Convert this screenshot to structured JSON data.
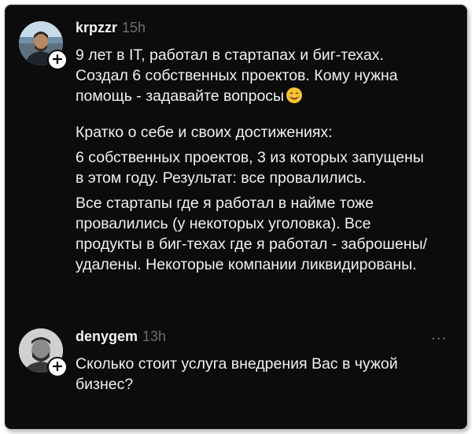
{
  "posts": [
    {
      "username": "krpzzr",
      "time": "15h",
      "paragraphs": [
        "9 лет в IT, работал в стартапах и биг-техах.\nСоздал 6 собственных проектов. Кому нужна\nпомощь - задавайте вопросы",
        "Кратко о себе и своих достижениях:",
        "6 собственных проектов, 3 из которых запущены\nв этом году. Результат: все провалились.",
        "Все стартапы где я работал в найме тоже\nпровалились (у некоторых уголовка). Все\nпродукты в биг-техах где я работал - заброшены/\nудалены. Некоторые компании ликвидированы."
      ],
      "emoji": "smiling-face-icon"
    },
    {
      "username": "denygem",
      "time": "13h",
      "more": "...",
      "paragraphs": [
        "Сколько стоит услуга внедрения Вас в чужой\nбизнес?"
      ]
    }
  ],
  "colors": {
    "background": "#0c0c0c",
    "text": "#f0f0f0",
    "muted": "#6d6d6d"
  }
}
